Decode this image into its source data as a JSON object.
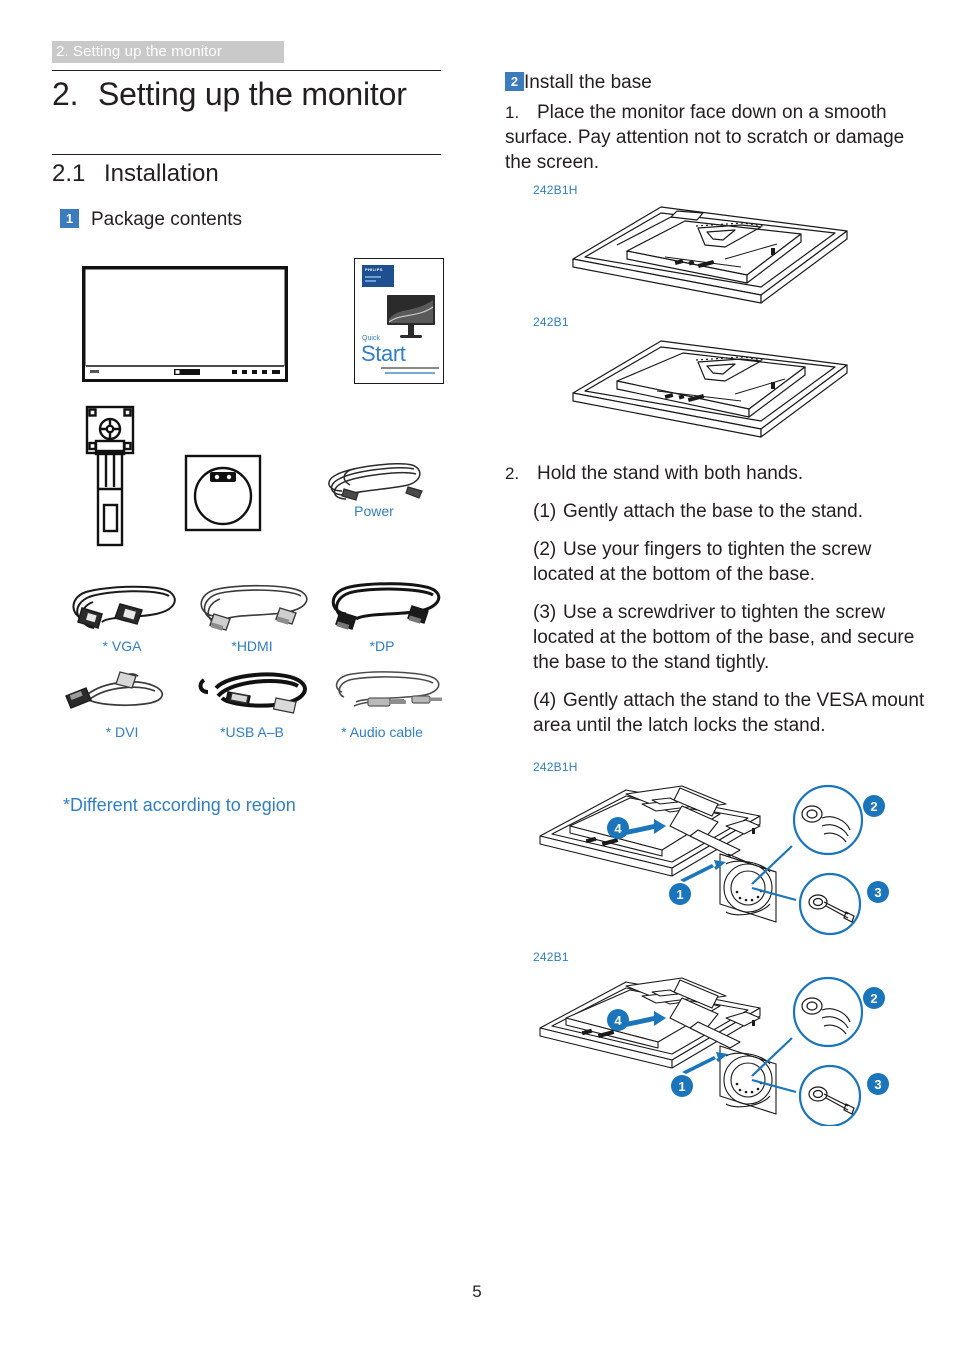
{
  "running_header": "2. Setting up the monitor",
  "chapter": {
    "number": "2.",
    "title": "Setting up the monitor"
  },
  "section": {
    "number": "2.1",
    "title": "Installation"
  },
  "left_column": {
    "subhead": {
      "badge": "1",
      "label": "Package contents"
    },
    "items": [
      {
        "name": "monitor",
        "caption": ""
      },
      {
        "name": "quick-start-guide",
        "caption": ""
      },
      {
        "name": "stand",
        "caption": ""
      },
      {
        "name": "base",
        "caption": ""
      },
      {
        "name": "power-cable",
        "caption": "Power"
      }
    ],
    "quick_start_guide": {
      "brand": "PHILIPS",
      "quick": "Quick",
      "start": "Start"
    },
    "cables": [
      {
        "caption": "* VGA"
      },
      {
        "caption": "*HDMI"
      },
      {
        "caption": "*DP"
      },
      {
        "caption": "* DVI"
      },
      {
        "caption": "*USB A–B"
      },
      {
        "caption": "* Audio cable"
      }
    ],
    "region_note": "*Different according to region"
  },
  "right_column": {
    "subhead": {
      "badge": "2",
      "label": "Install the base"
    },
    "step1": {
      "number": "1.",
      "text": "Place the monitor face down on a smooth surface. Pay attention not to scratch or damage the screen."
    },
    "fig1_label": "242B1H",
    "fig2_label": "242B1",
    "step2": {
      "number": "2.",
      "text": "Hold the stand with both hands."
    },
    "substeps": [
      {
        "number": "(1)",
        "text": "Gently attach the base to the stand."
      },
      {
        "number": "(2)",
        "text": "Use your fingers to tighten the screw located at the bottom of the base."
      },
      {
        "number": "(3)",
        "text": "Use a screwdriver to tighten the screw located at the bottom of the base, and secure the base to the stand tightly."
      },
      {
        "number": "(4)",
        "text": "Gently attach the stand to the VESA mount area until the latch locks the stand."
      }
    ],
    "fig3_label": "242B1H",
    "fig4_label": "242B1",
    "callouts": [
      "1",
      "2",
      "3",
      "4"
    ]
  },
  "page_number": "5",
  "colors": {
    "accent_blue": "#2f7fc6",
    "badge_blue": "#3a7cbe",
    "callout_blue": "#1a75bb",
    "header_gray": "#c9c9c9",
    "ink": "#231f20"
  }
}
